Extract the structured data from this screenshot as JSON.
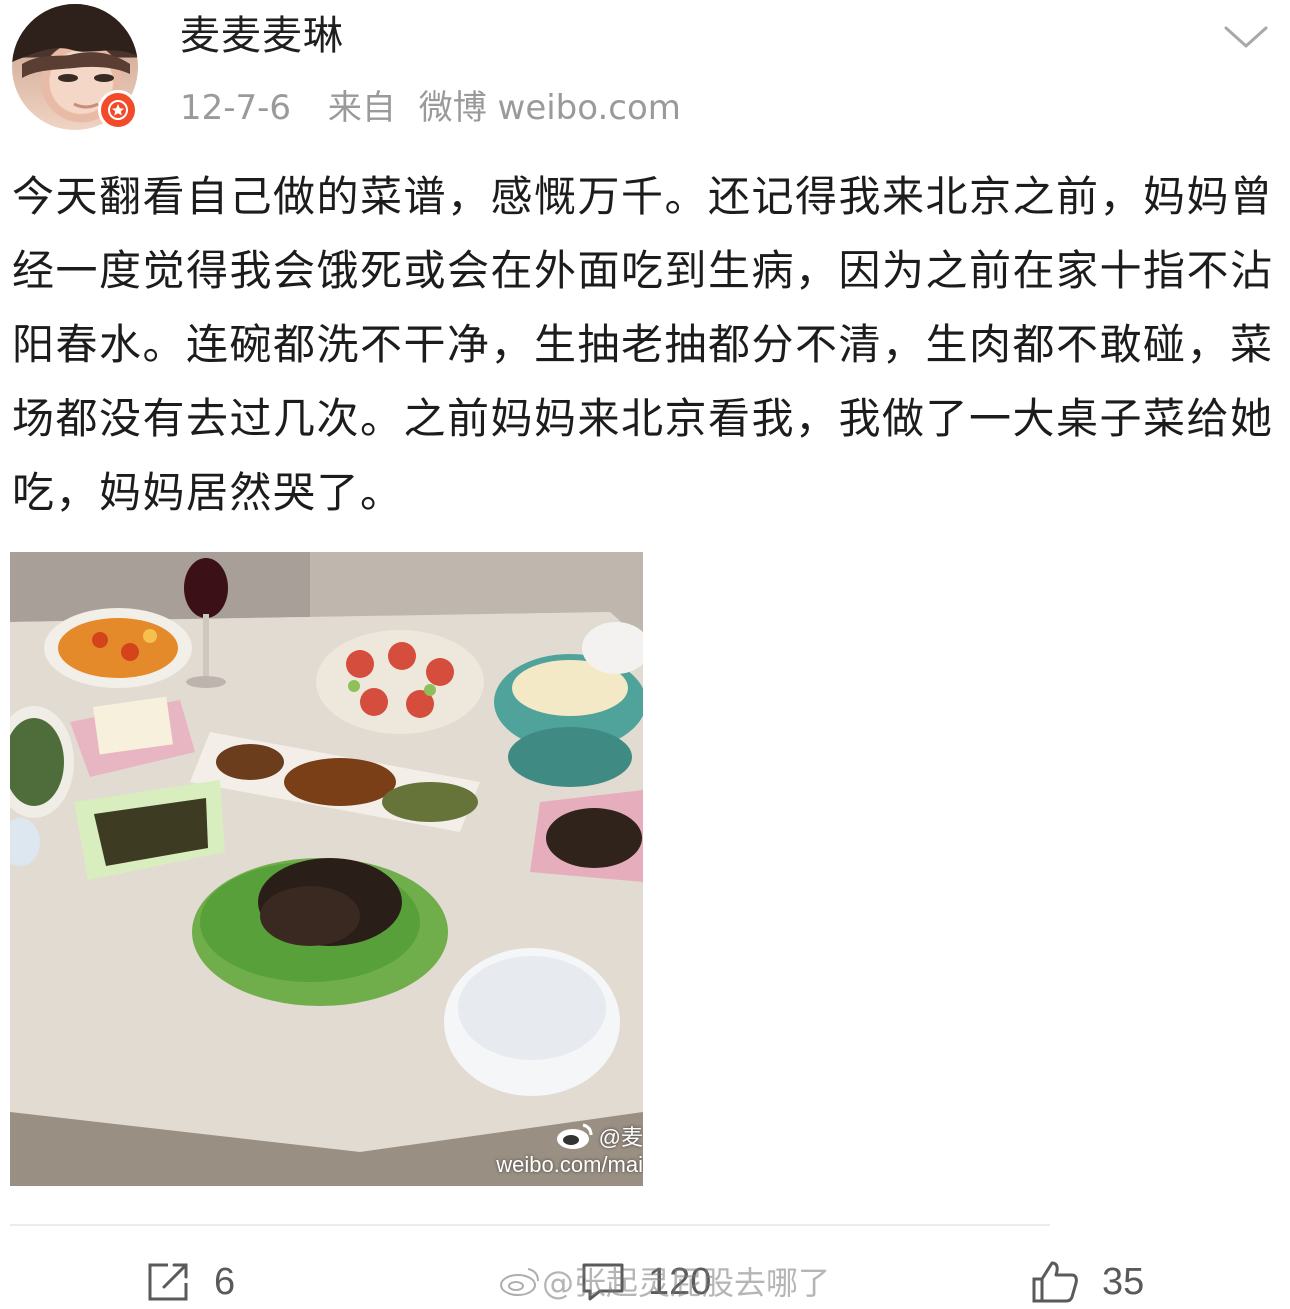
{
  "user": {
    "name": "麦麦麦琳",
    "avatar_icon": "user-avatar",
    "badge_icon": "verified-badge-icon",
    "badge_color": "#f24b2a"
  },
  "post": {
    "date": "12-7-6",
    "source_prefix": "来自",
    "source": "微博 weibo.com",
    "text": "今天翻看自己做的菜谱，感慨万千。还记得我来北京之前，妈妈曾经一度觉得我会饿死或会在外面吃到生病，因为之前在家十指不沾阳春水。连碗都洗不干净，生抽老抽都分不清，生肉都不敢碰，菜场都没有去过几次。之前妈妈来北京看我，我做了一大桌子菜给她吃，妈妈居然哭了。",
    "image_alt_icon": "food-photo",
    "image_watermark_handle": "@麦",
    "image_watermark_url": "weibo.com/mai"
  },
  "actions": {
    "repost_count": "6",
    "comment_count": "120",
    "like_count": "35"
  },
  "overlay_watermark": "@张起灵屁股去哪了"
}
